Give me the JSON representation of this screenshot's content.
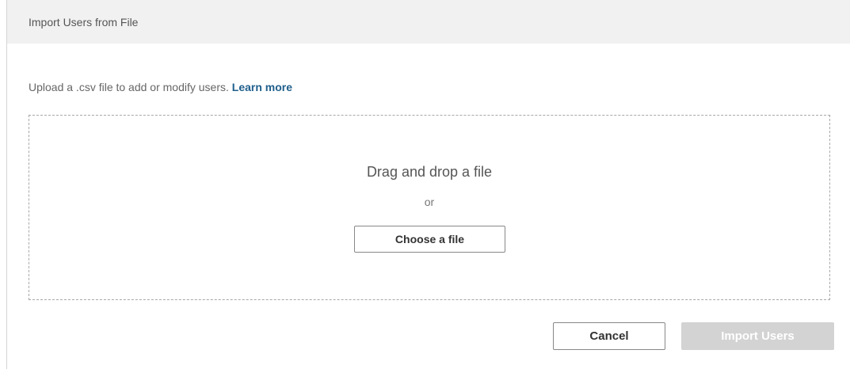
{
  "dialog": {
    "title": "Import Users from File",
    "description": "Upload a .csv file to add or modify users.",
    "learn_more_label": "Learn more"
  },
  "drop_zone": {
    "primary_text": "Drag and drop a file",
    "or_text": "or",
    "choose_label": "Choose a file"
  },
  "footer": {
    "cancel_label": "Cancel",
    "import_label": "Import Users",
    "import_enabled": false
  },
  "colors": {
    "header_bg": "#f1f1f1",
    "link": "#1f5f8b",
    "disabled_button_bg": "#d3d3d3",
    "border": "#a8a8a8"
  }
}
